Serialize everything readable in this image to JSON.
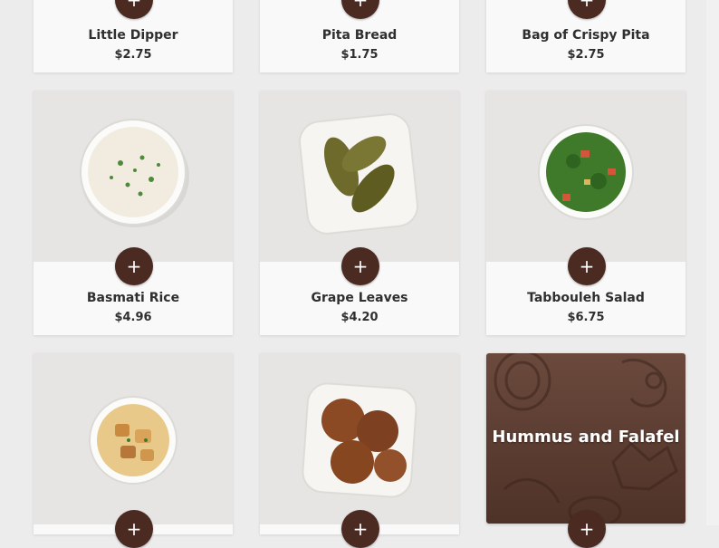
{
  "menu_items": [
    {
      "name": "Little Dipper",
      "price": "$2.75"
    },
    {
      "name": "Pita Bread",
      "price": "$1.75"
    },
    {
      "name": "Bag of Crispy Pita",
      "price": "$2.75"
    },
    {
      "name": "Basmati Rice",
      "price": "$4.96"
    },
    {
      "name": "Grape Leaves",
      "price": "$4.20"
    },
    {
      "name": "Tabbouleh Salad",
      "price": "$6.75"
    }
  ],
  "add_button": {
    "symbol": "+"
  },
  "promo": {
    "title": "Hummus and Falafel"
  },
  "colors": {
    "button": "#4a2a21",
    "card": "#f9f9f9",
    "page": "#ececec",
    "promo": "#5a3b30"
  }
}
